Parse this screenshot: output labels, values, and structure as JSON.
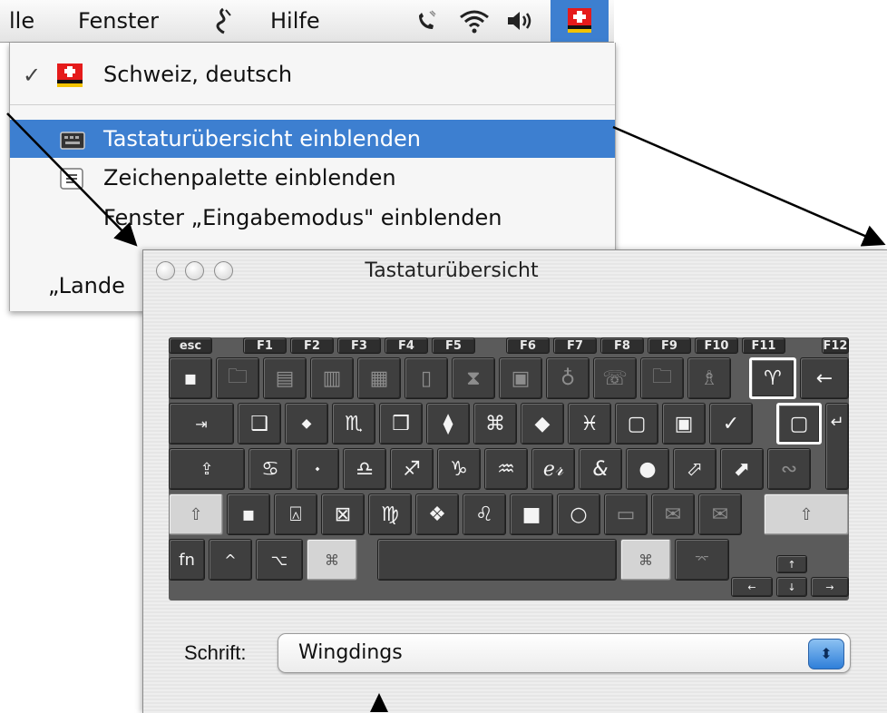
{
  "menubar": {
    "items": [
      "lle",
      "Fenster",
      "Hilfe"
    ],
    "icons": [
      "script-menu-icon",
      "phone-icon",
      "wifi-icon",
      "volume-icon",
      "swiss-flag-icon"
    ]
  },
  "input_menu": {
    "selected_layout": "Schweiz, deutsch",
    "checkmark": "✓",
    "items": [
      {
        "label": "Tastaturübersicht einblenden",
        "highlighted": true
      },
      {
        "label": "Zeichenpalette einblenden"
      },
      {
        "label": "Fenster „Eingabemodus\" einblenden"
      }
    ],
    "truncated_item": "„Lande"
  },
  "keyboard_viewer": {
    "title": "Tastaturübersicht",
    "fkeys": [
      "esc",
      "F1",
      "F2",
      "F3",
      "F4",
      "F5",
      "F6",
      "F7",
      "F8",
      "F9",
      "F10",
      "F11",
      "F12"
    ],
    "row1": [
      "▪",
      "🗀",
      "▤",
      "▥",
      "▦",
      "▯",
      "⧗",
      "▣",
      "♁",
      "☏",
      "🗀",
      "♗",
      "♈",
      "←"
    ],
    "row2": [
      "⇥",
      "❑",
      "◆",
      "♏",
      "❒",
      "⧫",
      "⌘",
      "◆",
      "♓",
      "▢",
      "▣",
      "✓",
      "▢",
      "↵"
    ],
    "row3": [
      "⇪",
      "♋",
      "⬩",
      "♎",
      "♐",
      "♑",
      "♒",
      "ℯ𝓇",
      "&",
      "●",
      "⬀",
      "⬈",
      "∾"
    ],
    "row4": [
      "⇧",
      "▪",
      "⍓",
      "⊠",
      "♍",
      "❖",
      "♌",
      "■",
      "○",
      "▭",
      "✉",
      "✉",
      "⇧"
    ],
    "row5": [
      "fn",
      "^",
      "⌥",
      "⌘",
      "",
      "⌘",
      "⌤"
    ],
    "arrows": [
      "↑",
      "←",
      "↓",
      "→"
    ],
    "font_label": "Schrift:",
    "font_value": "Wingdings",
    "stepper_glyph": "⬍"
  },
  "colors": {
    "menu_highlight": "#3d7fd0",
    "keyboard_bg": "#5b5b5b",
    "key": "#3f3f3f"
  }
}
